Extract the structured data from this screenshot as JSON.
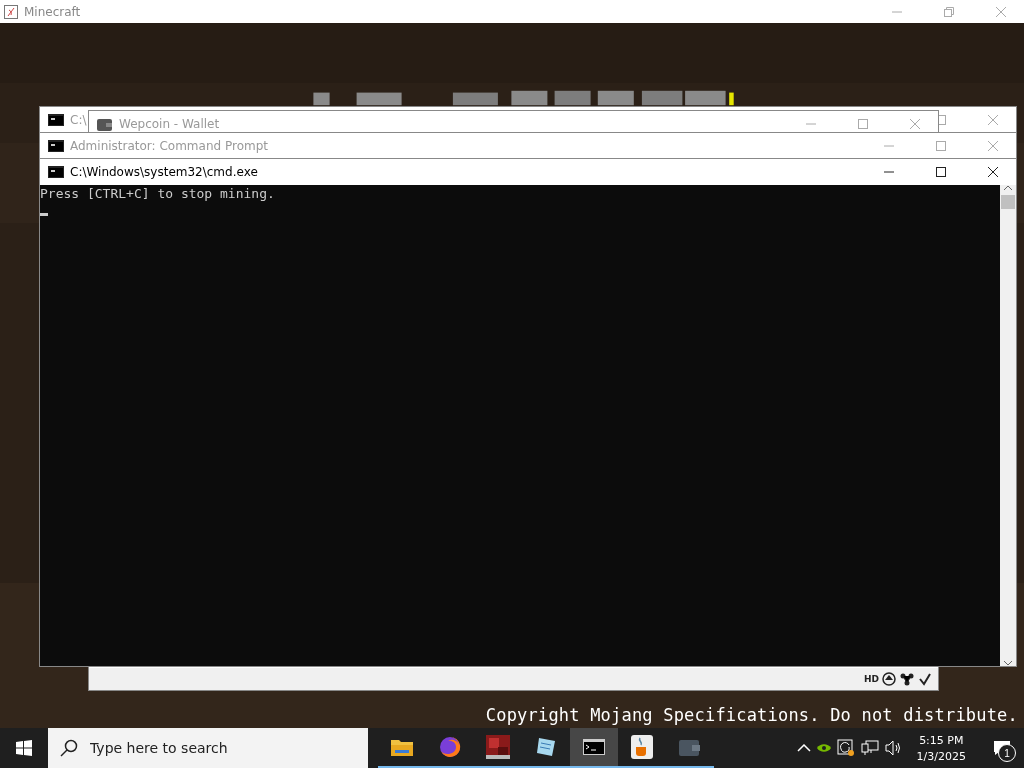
{
  "minecraft_window": {
    "title": "Minecraft",
    "copyright": "Copyright Mojang Specifications. Do not distribute."
  },
  "windows": [
    {
      "kind": "cmd",
      "title": "C:\\",
      "active": false
    },
    {
      "kind": "wallet",
      "title": "Wepcoin - Wallet",
      "active": false,
      "status_text": "HD"
    },
    {
      "kind": "cmd",
      "title": "Administrator: Command Prompt",
      "active": false
    },
    {
      "kind": "cmd",
      "title": "C:\\Windows\\system32\\cmd.exe",
      "active": true,
      "lines": [
        "Press [CTRL+C] to stop mining."
      ]
    }
  ],
  "taskbar": {
    "search": {
      "placeholder": "Type here to search"
    },
    "apps": [
      {
        "kind": "folder",
        "active": false
      },
      {
        "kind": "browser",
        "active": false
      },
      {
        "kind": "launcher",
        "active": false
      },
      {
        "kind": "notepad",
        "active": false
      },
      {
        "kind": "console",
        "active": true
      },
      {
        "kind": "java",
        "active": false
      },
      {
        "kind": "wallet",
        "active": false
      }
    ],
    "clock": {
      "time": "5:15 PM",
      "date": "1/3/2025"
    },
    "notifications": {
      "count": "1"
    }
  }
}
